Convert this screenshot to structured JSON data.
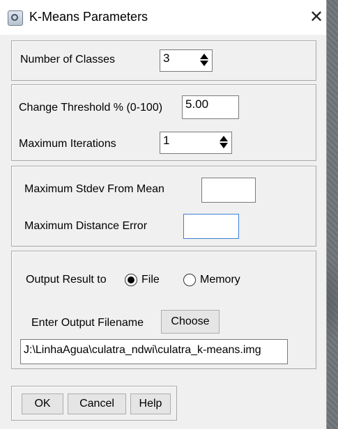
{
  "window": {
    "title": "K-Means Parameters",
    "close_glyph": "✕"
  },
  "classes": {
    "label": "Number of Classes",
    "value": "3"
  },
  "threshold": {
    "label": "Change Threshold % (0-100)",
    "value": "5.00"
  },
  "iterations": {
    "label": "Maximum Iterations",
    "value": "1"
  },
  "stdev": {
    "label": "Maximum Stdev From Mean",
    "value": ""
  },
  "distance": {
    "label": "Maximum Distance Error",
    "value": ""
  },
  "output": {
    "label": "Output Result to",
    "options": [
      "File",
      "Memory"
    ],
    "selected": "File",
    "filename_label": "Enter Output Filename",
    "choose_label": "Choose",
    "filename": "J:\\LinhaAgua\\culatra_ndwi\\culatra_k-means.img"
  },
  "buttons": {
    "ok": "OK",
    "cancel": "Cancel",
    "help": "Help"
  }
}
